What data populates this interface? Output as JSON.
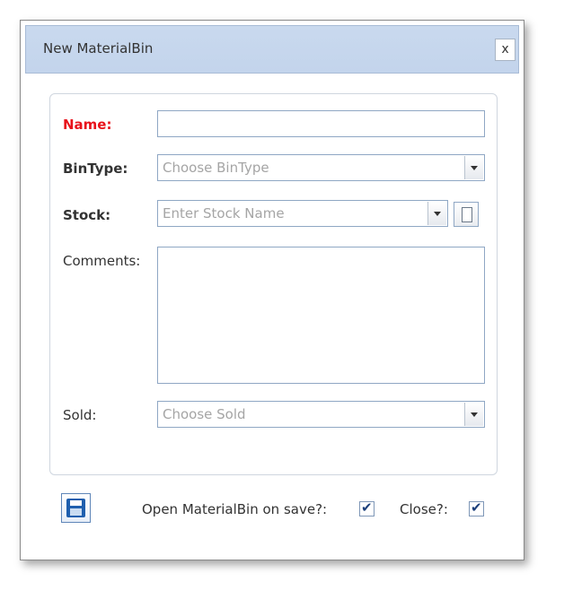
{
  "dialog": {
    "title": "New MaterialBin",
    "close_label": "x"
  },
  "form": {
    "name": {
      "label": "Name:",
      "value": "",
      "placeholder": ""
    },
    "bintype": {
      "label": "BinType:",
      "placeholder": "Choose BinType"
    },
    "stock": {
      "label": "Stock:",
      "placeholder": "Enter Stock Name"
    },
    "comments": {
      "label": "Comments:",
      "value": ""
    },
    "sold": {
      "label": "Sold:",
      "placeholder": "Choose Sold"
    }
  },
  "footer": {
    "open_on_save_label": "Open MaterialBin on save?:",
    "open_on_save_checked": true,
    "close_label": "Close?:",
    "close_checked": true,
    "check_glyph": "✔"
  },
  "icons": {
    "save": "floppy-disk-icon",
    "dropdown": "triangle-down-icon",
    "new_stock": "new-document-icon"
  },
  "colors": {
    "required_label": "#e8121b",
    "titlebar": "#c6d7ed",
    "field_border": "#8fa7c4"
  }
}
